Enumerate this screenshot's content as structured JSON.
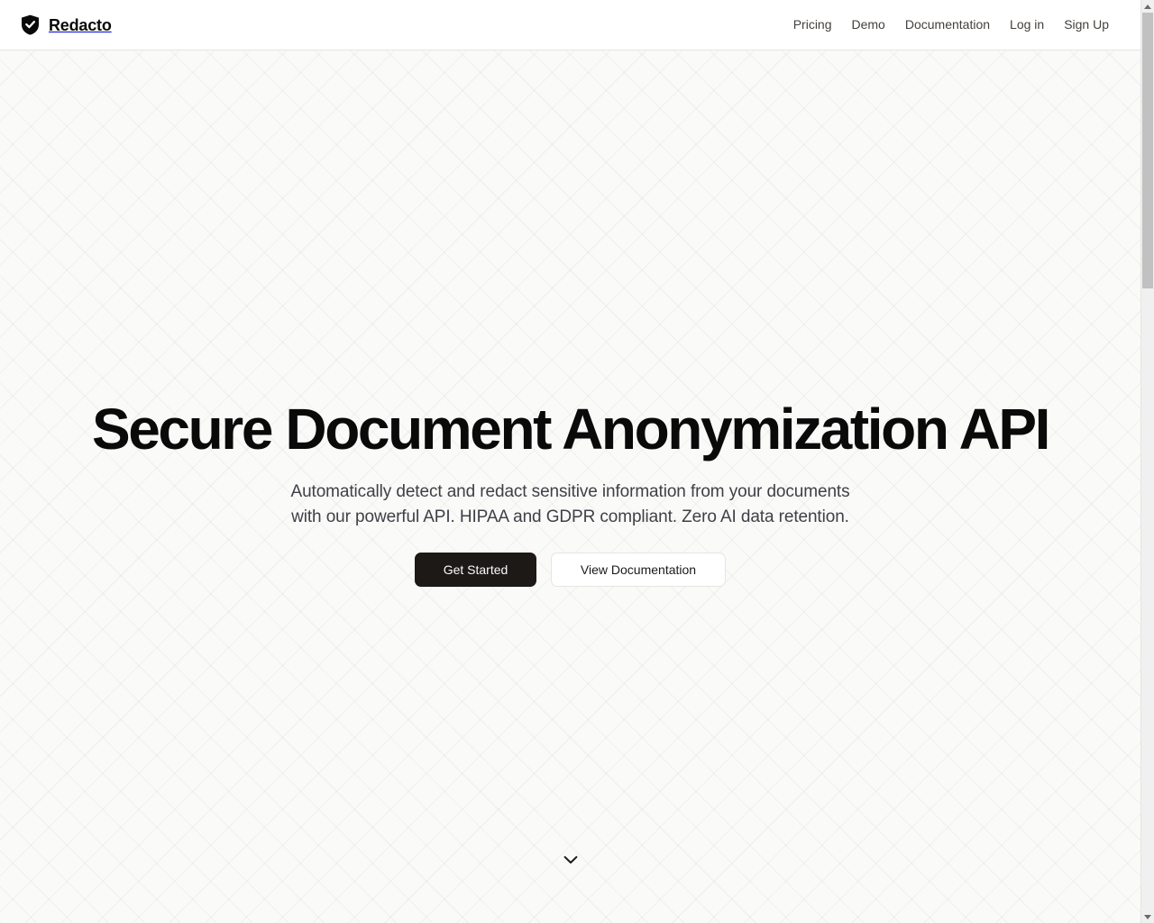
{
  "header": {
    "brand": {
      "name": "Redacto",
      "icon": "shield-check-icon"
    },
    "nav": [
      {
        "label": "Pricing",
        "name": "nav-link-pricing"
      },
      {
        "label": "Demo",
        "name": "nav-link-demo"
      },
      {
        "label": "Documentation",
        "name": "nav-link-documentation"
      },
      {
        "label": "Log in",
        "name": "nav-link-log-in"
      },
      {
        "label": "Sign Up",
        "name": "nav-link-sign-up"
      }
    ]
  },
  "hero": {
    "title": "Secure Document Anonymization API",
    "subtitle_line_1": "Automatically detect and redact sensitive information from your documents",
    "subtitle_line_2": "with our powerful API. HIPAA and GDPR compliant. Zero AI data retention.",
    "primary_cta": "Get Started",
    "secondary_cta": "View Documentation",
    "scroll_cue_icon": "chevron-down-icon"
  },
  "theme": {
    "page_background": "#fafaf9",
    "header_background": "#ffffff",
    "header_border": "#e7e5e4",
    "text_primary": "#0a0a0a",
    "text_secondary": "#3f3f46",
    "nav_link_color": "#44403c",
    "primary_button_background": "#1c1917",
    "primary_button_text": "#fafafa",
    "secondary_button_background": "#ffffff",
    "secondary_button_border": "#e7e5e4",
    "pattern_line_color": "rgba(28,25,23,0.045)"
  },
  "scrollbar": {
    "up_icon": "scroll-up-arrow-icon",
    "down_icon": "scroll-down-arrow-icon",
    "thumb_name": "scrollbar-thumb"
  }
}
